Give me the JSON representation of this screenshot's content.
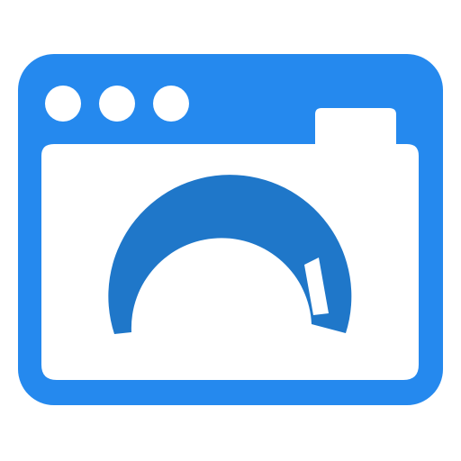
{
  "icon": {
    "name": "browser-window-gauge-icon",
    "primary_color": "#2589EE",
    "gauge_color": "#1F77C9",
    "content_color": "#FFFFFF"
  },
  "gauge": {
    "level_fraction": 0.9
  }
}
